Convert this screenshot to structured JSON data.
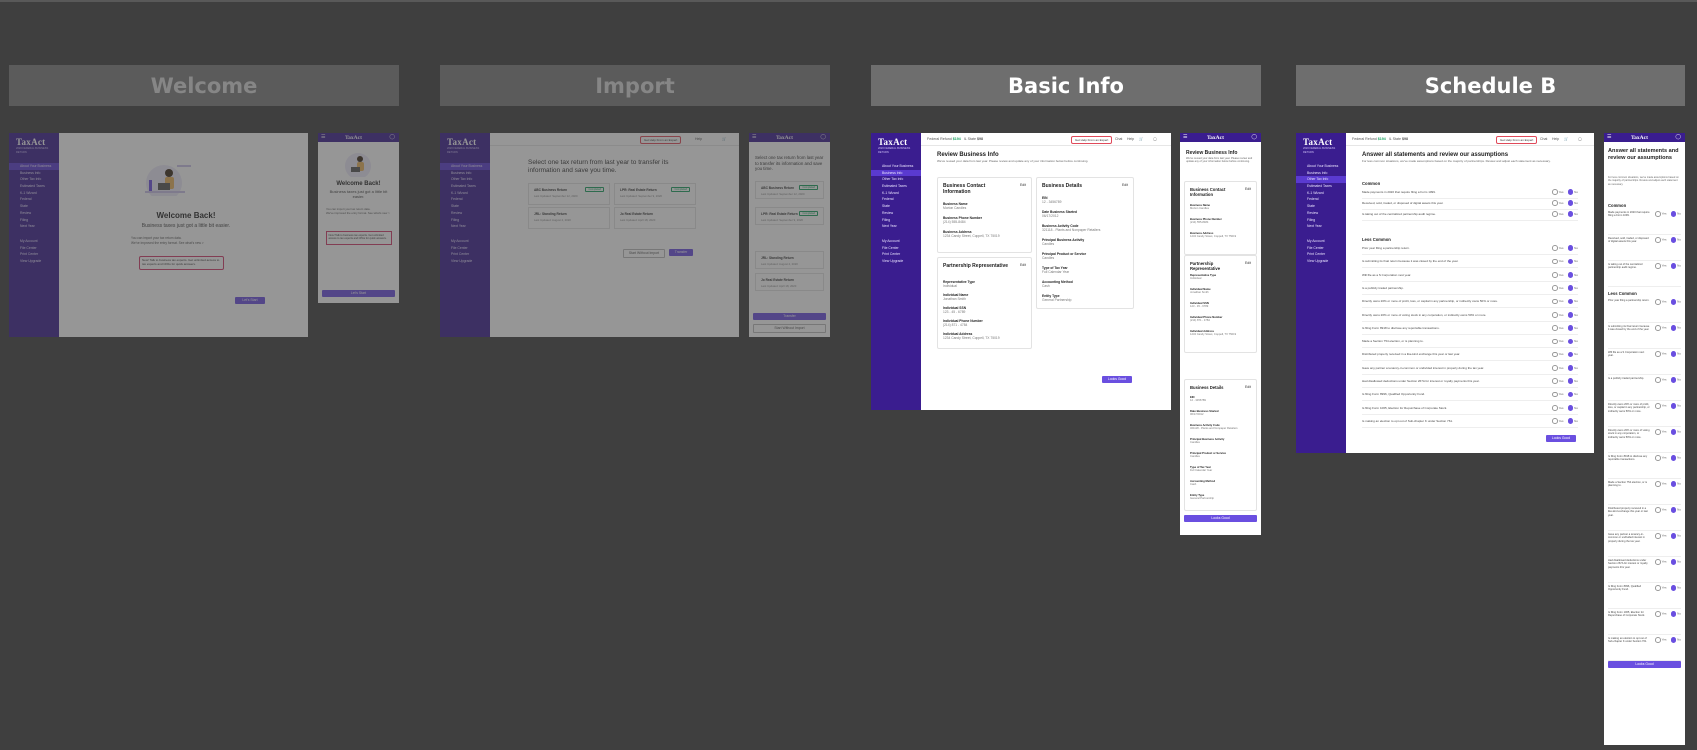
{
  "columns": [
    {
      "label": "Welcome",
      "active": false
    },
    {
      "label": "Import",
      "active": false
    },
    {
      "label": "Basic Info",
      "active": true
    },
    {
      "label": "Schedule B",
      "active": true
    }
  ],
  "brand": {
    "logo": "TaxAct",
    "tagline": "2020 FEDERAL BUSINESS RETURN"
  },
  "colors": {
    "sidebar": "#3a1d8f",
    "accent": "#6a4fe0",
    "canvas": "#3f3f3f",
    "active_tab": "#6e6e6e"
  },
  "sidebar": {
    "items": [
      "About Your Business",
      "Business Info",
      "Other Tax Info",
      "Estimated Taxes",
      "K-1 Wizard",
      "Federal",
      "State",
      "Review",
      "Filing",
      "Next Year"
    ],
    "links": [
      "My Account",
      "File Center",
      "Print Center",
      "View Upgrade"
    ]
  },
  "header": {
    "federal_label": "Federal Refund",
    "federal_value": "$194",
    "state_label": "IL State",
    "state_value": "$98",
    "expert_button": "Get Help From an Expert",
    "chat": "Chat",
    "help": "Help",
    "cart": "Cart",
    "account": "Account"
  },
  "welcome": {
    "title": "Welcome Back!",
    "subtitle": "Business taxes just got a little bit easier.",
    "bullet1": "You can import your tax return data.",
    "bullet2": "We've improved the entry format. See what's new >",
    "notice": "New! Talk to business tax experts. Get unlimited access to tax experts and CPAs for quick answers.",
    "cta": "Let's Start",
    "mobile_subtitle": "Business taxes just got a little bit easier."
  },
  "import": {
    "title": "Select one tax return from last year to transfer its information and save you time.",
    "mobile_title": "Select one tax return from last year to transfer its information and save you time.",
    "returns": [
      {
        "name": "ABC Business Return",
        "date": "Last Updated: September 12, 2020",
        "tag": "Completed"
      },
      {
        "name": "LPR: Real Estate Return",
        "date": "Last Updated: September 9, 2020",
        "tag": "Completed"
      },
      {
        "name": "JRL: Standing Return",
        "date": "Last Updated: August 4, 2020",
        "tag": ""
      },
      {
        "name": "Jo Real Estate Return",
        "date": "Last Updated: April 18, 2020",
        "tag": ""
      }
    ],
    "skip": "Start Without Import",
    "cta": "Transfer"
  },
  "basic": {
    "title": "Review Business Info",
    "desc": "We've reused your data from last year. Please review and update any of your information below before continuing.",
    "edit": "Edit",
    "contact": {
      "title": "Business Contact Information",
      "fields": [
        {
          "k": "Business Name",
          "v": "Morton Candles"
        },
        {
          "k": "Business Phone Number",
          "v": "(214) 555-8484"
        },
        {
          "k": "Business Address",
          "v": "1234 Candy Street, Coppell, TX 75019"
        }
      ]
    },
    "partner": {
      "title": "Partnership Representative",
      "fields": [
        {
          "k": "Representative Type",
          "v": "Individual"
        },
        {
          "k": "Individual Name",
          "v": "Jonathan Smith"
        },
        {
          "k": "Individual SSN",
          "v": "123 - 45 - 6789"
        },
        {
          "k": "Individual Phone Number",
          "v": "(214) 871 - 4784"
        },
        {
          "k": "Individual Address",
          "v": "1234 Candy Street, Coppell, TX 75019"
        }
      ]
    },
    "details": {
      "title": "Business Details",
      "fields": [
        {
          "k": "EIN",
          "v": "12 - 3456789"
        },
        {
          "k": "Date Business Started",
          "v": "06/17/2012"
        },
        {
          "k": "Business Activity Code",
          "v": "321118 - Plants and Nonpaper Retailers"
        },
        {
          "k": "Principal Business Activity",
          "v": "Candles"
        },
        {
          "k": "Principal Product or Service",
          "v": "Candles"
        },
        {
          "k": "Type of Tax Year",
          "v": "Full Calendar Year"
        },
        {
          "k": "Accounting Method",
          "v": "Cash"
        },
        {
          "k": "Entity Type",
          "v": "General Partnership"
        }
      ]
    },
    "cta": "Looks Good"
  },
  "schedb": {
    "title": "Answer all statements and review our assumptions",
    "desc": "For less common situations, we've made assumptions based on the majority of partnerships. Review and adjust each statement as necessary.",
    "common_label": "Common",
    "less_label": "Less Common",
    "yes": "Yes",
    "no": "No",
    "common": [
      "Made payments in 2020 that require filing a Form 1099.",
      "Received, sold, traded, or disposed of digital assets this year.",
      "Is taking out of the centralized partnership audit regime."
    ],
    "less": [
      "Prior year filing a partnership return.",
      "Is submitting its final return because it was closed by the end of the year.",
      "Will file as a S Corporation next year.",
      "Is a publicly traded partnership.",
      "Directly owns 20% or more of profit, loss, or capital in any partnership, or indirectly owns 50% or more.",
      "Directly owns 20% or more of voting stock in any corporation, or indirectly owns 50% or more.",
      "Is filing Form 8918 to disclose any reportable transactions.",
      "Made a Section 754 election, or is planning to.",
      "Distributed property received in a like-kind exchange this year or last year.",
      "Gave any partner a tenancy-in-common or undivided interest in property during the tax year.",
      "Had disallowed deductions under Section 267A for interest or royalty payments this year.",
      "Is filing Form 8996, Qualified Opportunity Fund.",
      "Is filing Form 1065, Election for Repurchase of Corporate Stock.",
      "Is making an election to opt out of Sub-chapter K under Section 761."
    ],
    "cta": "Looks Good"
  }
}
